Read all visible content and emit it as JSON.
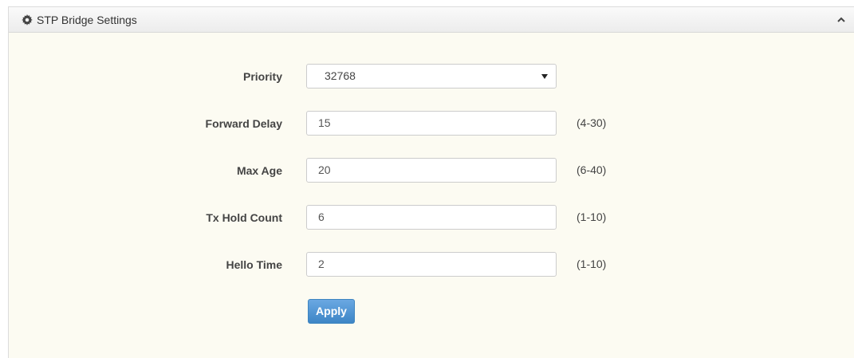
{
  "panel": {
    "title": "STP Bridge Settings",
    "header_icon": "gear-icon",
    "collapse_icon": "chevron-up-icon"
  },
  "form": {
    "priority": {
      "label": "Priority",
      "value": "32768",
      "icon": "caret-down-icon"
    },
    "forward_delay": {
      "label": "Forward Delay",
      "value": "15",
      "range": "(4-30)"
    },
    "max_age": {
      "label": "Max Age",
      "value": "20",
      "range": "(6-40)"
    },
    "tx_hold_count": {
      "label": "Tx Hold Count",
      "value": "6",
      "range": "(1-10)"
    },
    "hello_time": {
      "label": "Hello Time",
      "value": "2",
      "range": "(1-10)"
    },
    "apply_label": "Apply"
  },
  "colors": {
    "panel_background": "#fcfbf2",
    "apply_button": "#3d85c6",
    "label_text": "#444444"
  }
}
